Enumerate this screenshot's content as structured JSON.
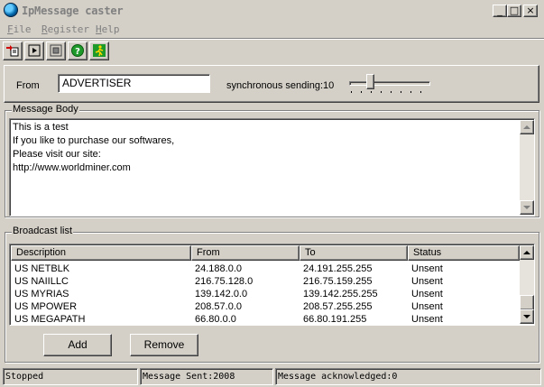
{
  "window": {
    "title": "IpMessage caster",
    "controls": {
      "minimize": "_",
      "maximize": "□",
      "close": "×"
    }
  },
  "menu": {
    "items": [
      {
        "label": "File",
        "accel": "F"
      },
      {
        "label": "Register",
        "accel": "R"
      },
      {
        "label": "Help",
        "accel": "H"
      }
    ]
  },
  "toolbar": {
    "buttons": [
      {
        "icon": "new-message-icon"
      },
      {
        "icon": "play-icon"
      },
      {
        "icon": "stop-icon"
      },
      {
        "icon": "help-icon"
      },
      {
        "icon": "exit-run-icon"
      }
    ]
  },
  "sender": {
    "from_label": "From",
    "from_value": "ADVERTISER",
    "sync_label": "synchronous sending:10",
    "sync_value": 10
  },
  "message_body": {
    "group_label": "Message Body",
    "text": "This is a test\nIf you like to purchase our softwares,\nPlease visit our site:\nhttp://www.worldminer.com"
  },
  "broadcast_list": {
    "group_label": "Broadcast list",
    "columns": [
      "Description",
      "From",
      "To",
      "Status"
    ],
    "rows": [
      [
        "US NETBLK",
        "24.188.0.0",
        "24.191.255.255",
        "Unsent"
      ],
      [
        "US NAIILLC",
        "216.75.128.0",
        "216.75.159.255",
        "Unsent"
      ],
      [
        "US MYRIAS",
        "139.142.0.0",
        "139.142.255.255",
        "Unsent"
      ],
      [
        "US MPOWER",
        "208.57.0.0",
        "208.57.255.255",
        "Unsent"
      ],
      [
        "US MEGAPATH",
        "66.80.0.0",
        "66.80.191.255",
        "Unsent"
      ]
    ],
    "add_label": "Add",
    "remove_label": "Remove"
  },
  "status": {
    "state": "Stopped",
    "sent": "Message Sent:2008",
    "acknowledged": "Message acknowledged:0"
  },
  "colors": {
    "face": "#d4d0c8",
    "shadow": "#808080",
    "disabled_text": "#808080"
  }
}
